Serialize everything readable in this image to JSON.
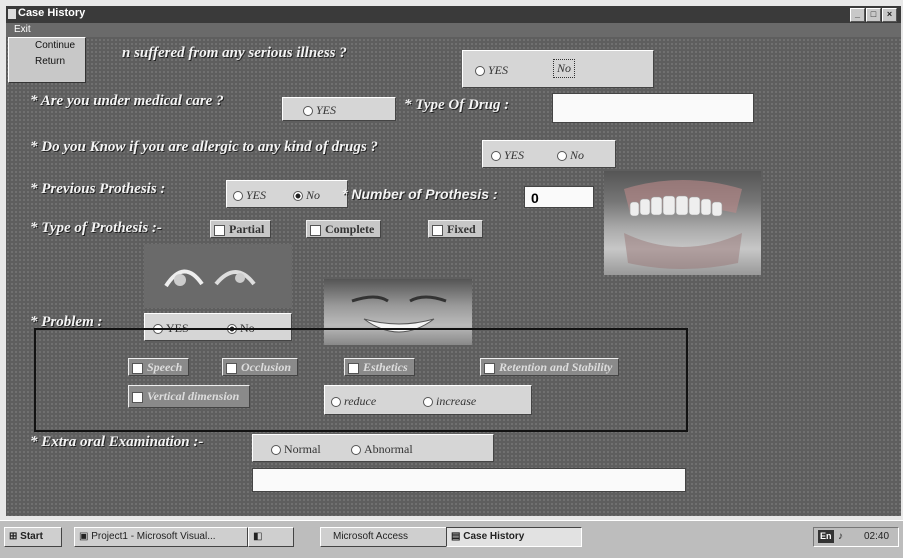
{
  "window": {
    "title": "Case History"
  },
  "menu": {
    "exit": "Exit",
    "items": [
      "Continue",
      "Return"
    ]
  },
  "q1": {
    "label": "n suffered from any serious illness ?",
    "yes": "YES",
    "no": "No"
  },
  "q2": {
    "label": "* Are you under medical care ?",
    "yes": "YES",
    "drug_label": "* Type Of Drug :",
    "drug_value": ""
  },
  "q3": {
    "label": "* Do you Know if you are allergic to any kind of drugs ?",
    "yes": "YES",
    "no": "No"
  },
  "q4": {
    "label": "* Previous Prothesis :",
    "yes": "YES",
    "no": "No",
    "num_label": "* Number of Prothesis :",
    "num_value": "0"
  },
  "q5": {
    "label": "* Type of Prothesis :-",
    "options": [
      "Partial",
      "Complete",
      "Fixed"
    ]
  },
  "q6": {
    "label": "* Problem :",
    "yes": "YES",
    "no": "No",
    "checks": [
      "Speech",
      "Occlusion",
      "Esthetics",
      "Retention and Stability",
      "Vertical dimension"
    ],
    "vd_options": [
      "reduce",
      "increase"
    ]
  },
  "q7": {
    "label": "* Extra oral Examination :-",
    "normal": "Normal",
    "abnormal": "Abnormal",
    "notes": ""
  },
  "taskbar": {
    "start": "Start",
    "items": [
      "Project1 - Microsoft Visual...",
      "",
      "Microsoft Access",
      "Case History"
    ],
    "lang": "En",
    "clock": "02:40"
  }
}
